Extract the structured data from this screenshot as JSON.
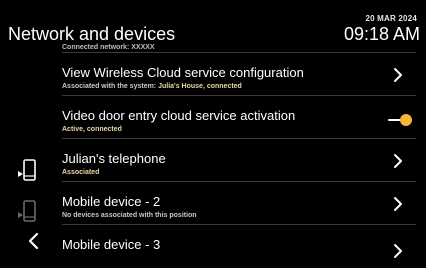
{
  "header": {
    "title": "Network and devices",
    "date": "20 MAR 2024",
    "time": "09:18 AM"
  },
  "partial_item": {
    "sub": "Connected network: XXXXX"
  },
  "items": [
    {
      "label": "View Wireless Cloud service configuration",
      "sub_prefix": "Associated with the system: ",
      "sub_value": "Julia's House, connected",
      "control": "chevron-right-icon"
    },
    {
      "label": "Video door entry cloud service activation",
      "sub_prefix": "Active, connected",
      "sub_value": "",
      "control": "toggle-on",
      "toggle_state": "on"
    },
    {
      "label": "Julian's telephone",
      "sub_prefix": "Associated",
      "sub_value": "",
      "control": "chevron-right-icon",
      "icon": "phone-icon"
    },
    {
      "label": "Mobile device - 2",
      "sub_prefix": "No devices associated with this position",
      "sub_value": "",
      "control": "chevron-right-icon",
      "icon": "phone-icon-dim"
    },
    {
      "label": "Mobile device - 3",
      "sub_prefix": "",
      "sub_value": "",
      "control": "chevron-right-icon"
    }
  ],
  "colors": {
    "background": "#000000",
    "text": "#ffffff",
    "subtext_accent": "#e8d7a8",
    "toggle_knob": "#f5b73a",
    "divider": "#3a3a3a"
  },
  "nav": {
    "back_icon": "chevron-left-icon"
  }
}
